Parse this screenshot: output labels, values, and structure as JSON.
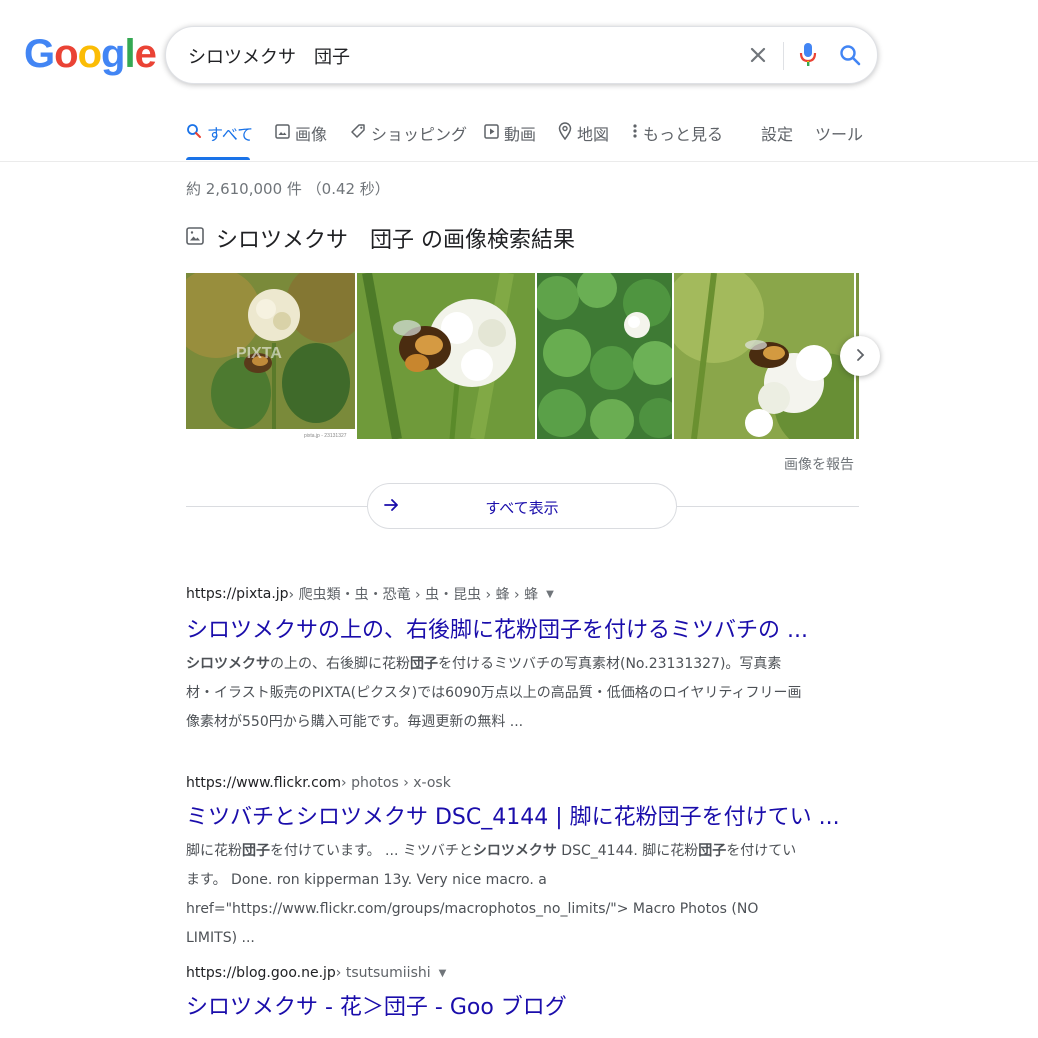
{
  "search": {
    "query": "シロツメクサ　団子",
    "logo_letters": [
      "G",
      "o",
      "o",
      "g",
      "l",
      "e"
    ]
  },
  "tabs": [
    {
      "label": "すべて",
      "icon": "search-icon"
    },
    {
      "label": "画像",
      "icon": "image-icon"
    },
    {
      "label": "ショッピング",
      "icon": "tag-icon"
    },
    {
      "label": "動画",
      "icon": "play-icon"
    },
    {
      "label": "地図",
      "icon": "map-pin-icon"
    },
    {
      "label": "もっと見る",
      "icon": "more-vert-icon"
    },
    {
      "label": "設定"
    },
    {
      "label": "ツール"
    }
  ],
  "stats": "約 2,610,000 件 （0.42 秒）",
  "image_section": {
    "title": "シロツメクサ　団子 の画像検索結果",
    "report": "画像を報告",
    "show_all": "すべて表示",
    "watermark": "PIXTA",
    "thumb_caption": "pixta.jp - 23131327"
  },
  "results": [
    {
      "site": "https://pixta.jp",
      "path": " › 爬虫類・虫・恐竜 › 虫・昆虫 › 蜂 › 蜂",
      "title": "シロツメクサの上の、右後脚に花粉団子を付けるミツバチの ...",
      "snippet_parts": [
        {
          "b": true,
          "t": "シロツメクサ"
        },
        {
          "t": "の上の、右後脚に花粉"
        },
        {
          "b": true,
          "t": "団子"
        },
        {
          "t": "を付けるミツバチの写真素材(No.23131327)。写真素材・イラスト販売のPIXTA(ピクスタ)では6090万点以上の高品質・低価格のロイヤリティフリー画像素材が550円から購入可能です。毎週更新の無料 ..."
        }
      ]
    },
    {
      "site": "https://www.flickr.com",
      "path": " › photos › x-osk",
      "title": "ミツバチとシロツメクサ DSC_4144 | 脚に花粉団子を付けてい ...",
      "snippet_parts": [
        {
          "t": "脚に花粉"
        },
        {
          "b": true,
          "t": "団子"
        },
        {
          "t": "を付けています。 ... ミツバチと"
        },
        {
          "b": true,
          "t": "シロツメクサ"
        },
        {
          "t": " DSC_4144. 脚に花粉"
        },
        {
          "b": true,
          "t": "団子"
        },
        {
          "t": "を付けています。 Done. ron kipperman 13y. Very nice macro. a href=\"https://www.flickr.com/groups/macrophotos_no_limits/\"> Macro Photos (NO LIMITS) ..."
        }
      ]
    },
    {
      "site": "https://blog.goo.ne.jp",
      "path": " › tsutsumiishi",
      "title": "シロツメクサ - 花＞団子 - Goo ブログ",
      "snippet_parts": []
    }
  ],
  "colors": {
    "link": "#1a0dab",
    "accent": "#1a73e8",
    "google_blue": "#4285F4",
    "google_red": "#EA4335",
    "google_yellow": "#FBBC05",
    "google_green": "#34A853"
  }
}
